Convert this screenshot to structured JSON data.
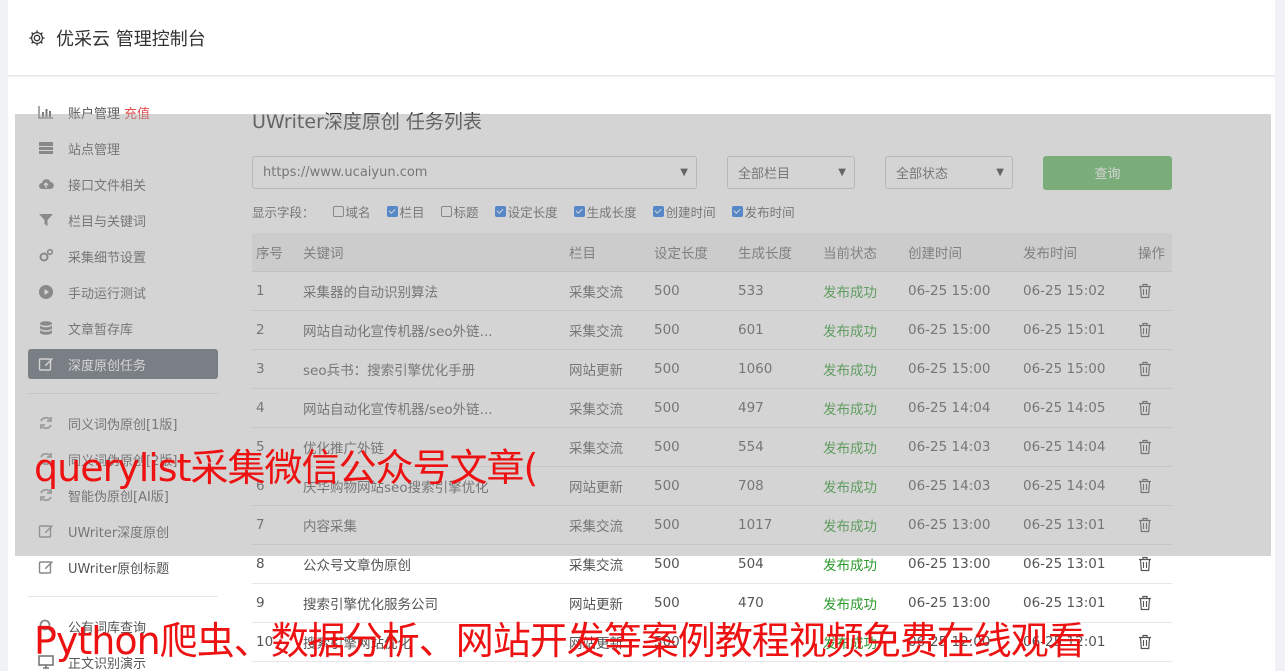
{
  "header": {
    "title": "优采云 管理控制台",
    "icon": "gear-icon"
  },
  "sidebar": {
    "items": [
      {
        "label": "账户管理",
        "extra": "充值",
        "icon": "bar-chart-icon"
      },
      {
        "label": "站点管理",
        "icon": "server-icon"
      },
      {
        "label": "接口文件相关",
        "icon": "cloud-upload-icon"
      },
      {
        "label": "栏目与关键词",
        "icon": "filter-icon"
      },
      {
        "label": "采集细节设置",
        "icon": "gears-icon"
      },
      {
        "label": "手动运行测试",
        "icon": "play-circle-icon"
      },
      {
        "label": "文章暂存库",
        "icon": "database-icon"
      },
      {
        "label": "深度原创任务",
        "icon": "edit-icon",
        "active": true
      }
    ],
    "items2": [
      {
        "label": "同义词伪原创[1版]",
        "icon": "refresh-icon"
      },
      {
        "label": "同义词伪原创[2版]",
        "icon": "refresh-icon"
      },
      {
        "label": "智能伪原创[AI版]",
        "icon": "refresh-icon"
      },
      {
        "label": "UWriter深度原创",
        "icon": "edit-icon"
      },
      {
        "label": "UWriter原创标题",
        "icon": "edit-icon"
      }
    ],
    "items3": [
      {
        "label": "公有词库查询",
        "icon": "search-icon"
      },
      {
        "label": "正文识别演示",
        "icon": "monitor-icon"
      }
    ]
  },
  "main": {
    "title": "UWriter深度原创 任务列表",
    "site_select": "https://www.ucaiyun.com",
    "column_select": "全部栏目",
    "status_select": "全部状态",
    "query_button": "查询",
    "fields_label": "显示字段：",
    "fields": [
      {
        "label": "域名",
        "checked": false
      },
      {
        "label": "栏目",
        "checked": true
      },
      {
        "label": "标题",
        "checked": false
      },
      {
        "label": "设定长度",
        "checked": true
      },
      {
        "label": "生成长度",
        "checked": true
      },
      {
        "label": "创建时间",
        "checked": true
      },
      {
        "label": "发布时间",
        "checked": true
      }
    ],
    "columns": [
      "序号",
      "关键词",
      "栏目",
      "设定长度",
      "生成长度",
      "当前状态",
      "创建时间",
      "发布时间",
      "操作"
    ],
    "rows": [
      [
        "1",
        "采集器的自动识别算法",
        "采集交流",
        "500",
        "533",
        "发布成功",
        "06-25 15:00",
        "06-25 15:02"
      ],
      [
        "2",
        "网站自动化宣传机器/seo外链...",
        "采集交流",
        "500",
        "601",
        "发布成功",
        "06-25 15:00",
        "06-25 15:01"
      ],
      [
        "3",
        "seo兵书：搜索引擎优化手册",
        "网站更新",
        "500",
        "1060",
        "发布成功",
        "06-25 15:00",
        "06-25 15:00"
      ],
      [
        "4",
        "网站自动化宣传机器/seo外链...",
        "采集交流",
        "500",
        "497",
        "发布成功",
        "06-25 14:04",
        "06-25 14:05"
      ],
      [
        "5",
        "优化推广外链",
        "采集交流",
        "500",
        "554",
        "发布成功",
        "06-25 14:03",
        "06-25 14:04"
      ],
      [
        "6",
        "庆华购物网站seo搜索引擎优化",
        "网站更新",
        "500",
        "708",
        "发布成功",
        "06-25 14:03",
        "06-25 14:04"
      ],
      [
        "7",
        "内容采集",
        "采集交流",
        "500",
        "1017",
        "发布成功",
        "06-25 13:00",
        "06-25 13:01"
      ],
      [
        "8",
        "公众号文章伪原创",
        "采集交流",
        "500",
        "504",
        "发布成功",
        "06-25 13:00",
        "06-25 13:01"
      ],
      [
        "9",
        "搜索引擎优化服务公司",
        "网站更新",
        "500",
        "470",
        "发布成功",
        "06-25 13:00",
        "06-25 13:01"
      ],
      [
        "10",
        "搜索引擎网站优化",
        "网站更新",
        "500",
        "",
        "发布成功",
        "06-25 12:00",
        "06-25 12:01"
      ]
    ]
  },
  "watermark": {
    "line1": "querylist采集微信公众号文章(",
    "line2": "Python爬虫、数据分析、网站开发等案例教程视频免费在线观看"
  }
}
